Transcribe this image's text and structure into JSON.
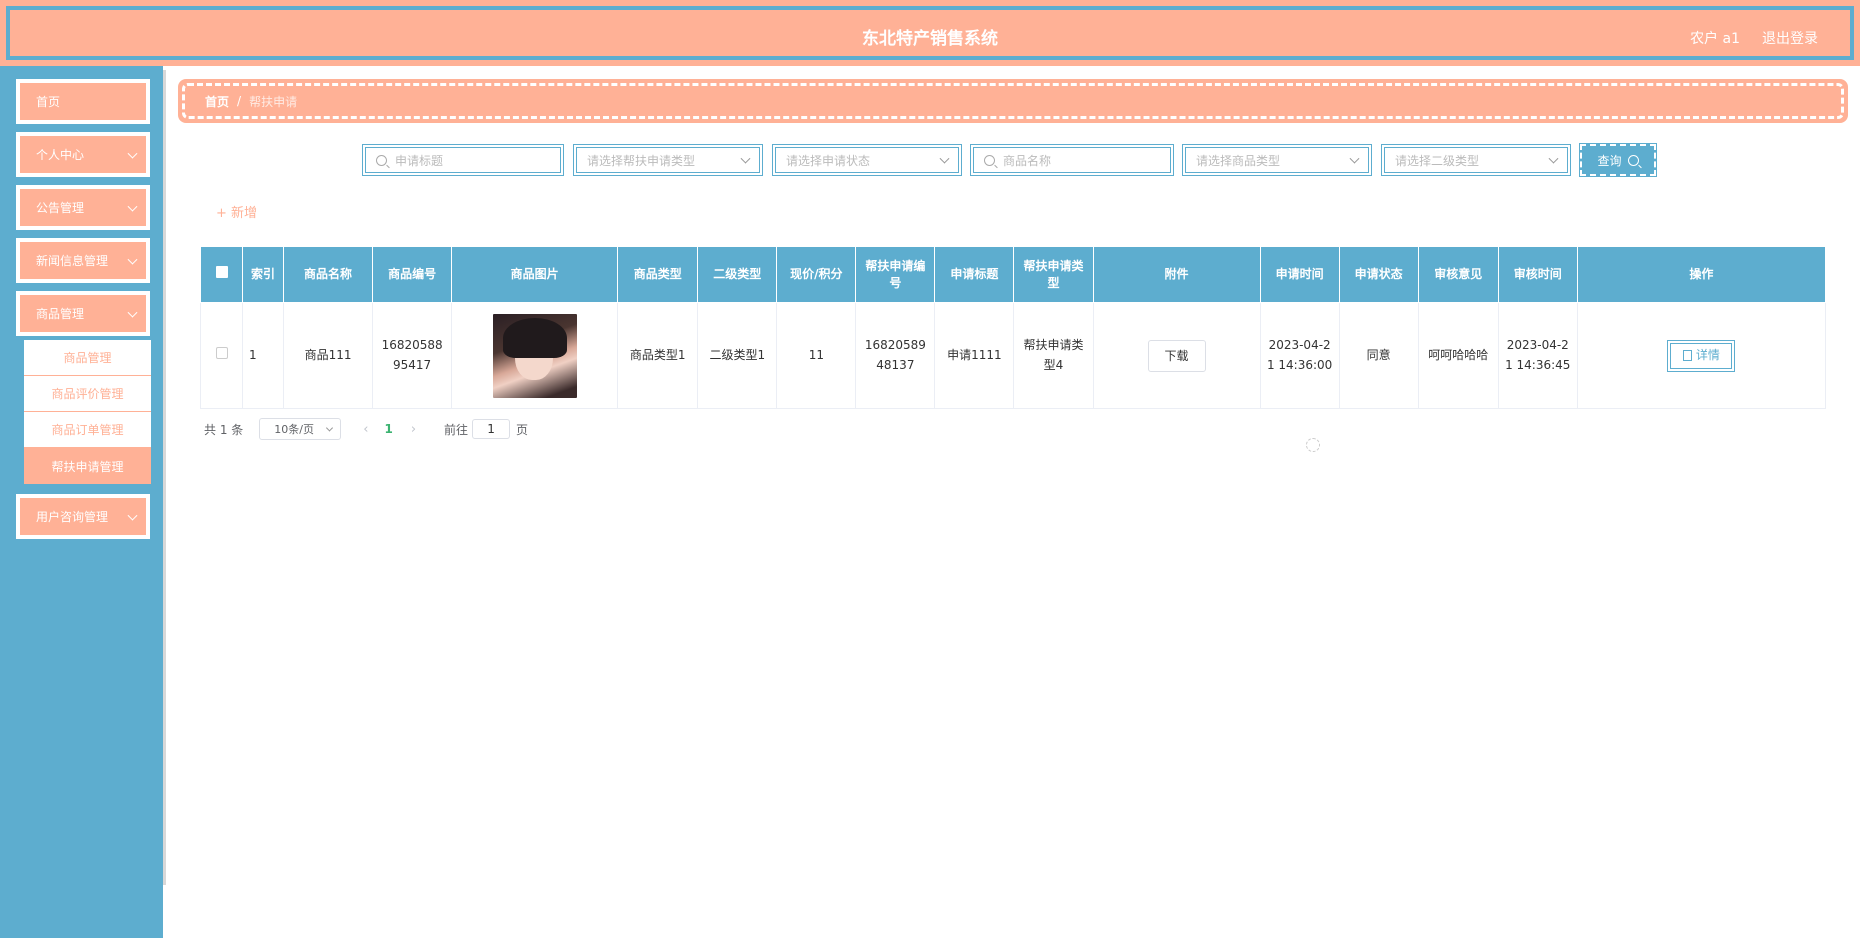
{
  "header": {
    "title": "东北特产销售系统",
    "user": "农户 a1",
    "logout": "退出登录"
  },
  "sidebar": {
    "items": [
      {
        "label": "首页",
        "has_chevron": false
      },
      {
        "label": "个人中心",
        "has_chevron": true
      },
      {
        "label": "公告管理",
        "has_chevron": true
      },
      {
        "label": "新闻信息管理",
        "has_chevron": true
      },
      {
        "label": "商品管理",
        "has_chevron": true
      },
      {
        "label": "用户咨询管理",
        "has_chevron": true
      }
    ],
    "submenu": [
      {
        "label": "商品管理",
        "active": false
      },
      {
        "label": "商品评价管理",
        "active": false
      },
      {
        "label": "商品订单管理",
        "active": false
      },
      {
        "label": "帮扶申请管理",
        "active": true
      }
    ]
  },
  "breadcrumb": {
    "home": "首页",
    "separator": "/",
    "current": "帮扶申请"
  },
  "search": {
    "title_placeholder": "申请标题",
    "apply_type_placeholder": "请选择帮扶申请类型",
    "status_placeholder": "请选择申请状态",
    "product_name_placeholder": "商品名称",
    "product_type_placeholder": "请选择商品类型",
    "sub_type_placeholder": "请选择二级类型",
    "query_label": "查询"
  },
  "toolbar": {
    "add_label": "+ 新增"
  },
  "table": {
    "headers": [
      "索引",
      "商品名称",
      "商品编号",
      "商品图片",
      "商品类型",
      "二级类型",
      "现价/积分",
      "帮扶申请编号",
      "申请标题",
      "帮扶申请类型",
      "附件",
      "申请时间",
      "申请状态",
      "审核意见",
      "审核时间",
      "操作"
    ],
    "rows": [
      {
        "index": "1",
        "product_name": "商品111",
        "product_no": "1682058895417",
        "product_type": "商品类型1",
        "sub_type": "二级类型1",
        "price": "11",
        "apply_no": "1682058948137",
        "apply_title": "申请1111",
        "apply_type": "帮扶申请类型4",
        "attachment_label": "下载",
        "apply_time": "2023-04-21 14:36:00",
        "status": "同意",
        "review_opinion": "呵呵哈哈哈",
        "review_time": "2023-04-21 14:36:45",
        "action_label": "详情"
      }
    ]
  },
  "pagination": {
    "total": "共 1 条",
    "page_size": "10条/页",
    "current_page": "1",
    "goto_label": "前往",
    "goto_value": "1",
    "page_suffix": "页"
  },
  "colors": {
    "accent": "#ffb196",
    "primary": "#5dadcf"
  }
}
